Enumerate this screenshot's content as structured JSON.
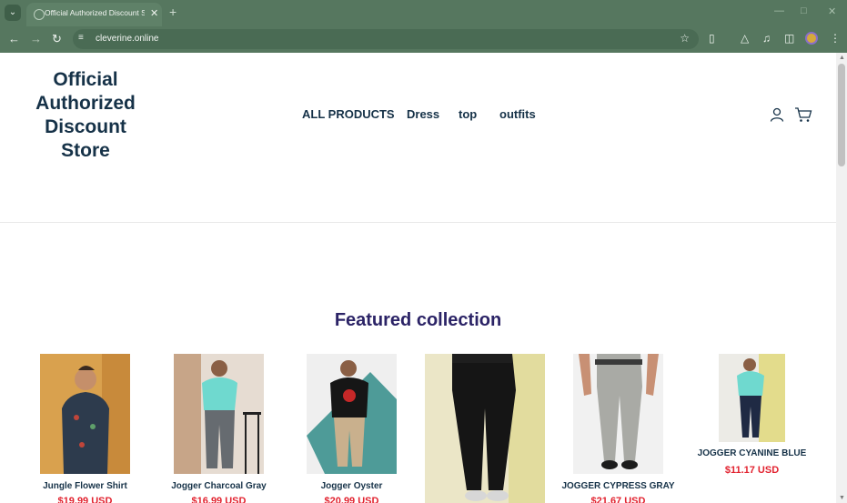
{
  "browser": {
    "tab_title": "Official Authorized Discount Store",
    "url": "cleverine.online"
  },
  "store": {
    "logo_lines": [
      "Official",
      "Authorized",
      "Discount",
      "Store"
    ],
    "nav": [
      "ALL PRODUCTS",
      "Dress",
      "top",
      "outfits"
    ]
  },
  "featured": {
    "title": "Featured collection",
    "products": [
      {
        "name": "Jungle Flower Shirt",
        "price": "$19.99 USD"
      },
      {
        "name": "Jogger Charcoal Gray",
        "price": "$16.99 USD"
      },
      {
        "name": "Jogger Oyster",
        "price": "$20.99 USD"
      },
      {
        "name": "",
        "price": ""
      },
      {
        "name": "JOGGER CYPRESS GRAY",
        "price": "$21.67 USD"
      },
      {
        "name": "JOGGER CYANINE BLUE",
        "price": "$11.17 USD"
      }
    ]
  },
  "colors": {
    "chrome": "#56775f",
    "brand_text": "#163248",
    "heading": "#2b2366",
    "price": "#e2222f"
  }
}
